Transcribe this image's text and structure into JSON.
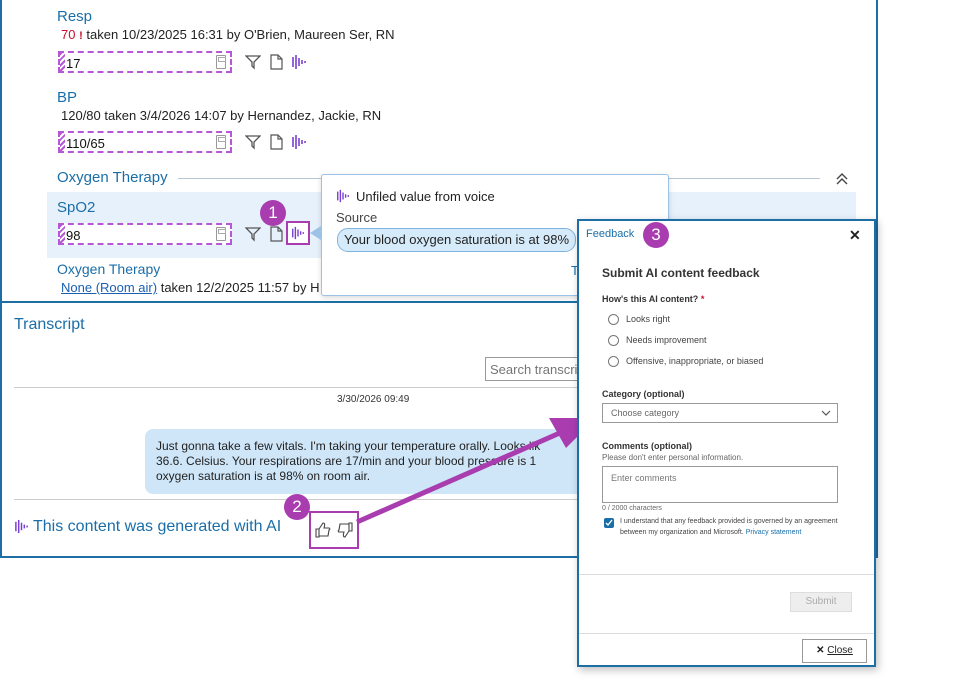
{
  "vitals": {
    "resp": {
      "label": "Resp",
      "prev_value": "70",
      "warn_icon": "!",
      "taken": "taken 10/23/2025 16:31 by O'Brien, Maureen Ser, RN",
      "input_value": "17"
    },
    "bp": {
      "label": "BP",
      "prev_value": "120/80",
      "taken": "taken 3/4/2026 14:07 by Hernandez, Jackie, RN",
      "input_value": "110/65"
    },
    "oxygen_section": {
      "title": "Oxygen Therapy"
    },
    "spo2": {
      "label": "SpO2",
      "input_value": "98"
    },
    "oxygen_row": {
      "label": "Oxygen Therapy",
      "prev_value": "None (Room air)",
      "taken": "taken 12/2/2025 11:57 by H"
    }
  },
  "popup": {
    "title": "Unfiled value from voice",
    "source_label": "Source",
    "source_text": "Your blood oxygen saturation is at 98%",
    "truncated_link": "T"
  },
  "transcript": {
    "title": "Transcript",
    "search_placeholder": "Search transcri",
    "timestamp": "3/30/2026 09:49",
    "bubble_line1": "Just gonna take a few vitals. I'm taking your temperature orally. Looks lik",
    "bubble_line2": "36.6. Celsius. Your respirations are 17/min and your blood pressure is 1",
    "bubble_line3": "oxygen saturation is at 98% on room air.",
    "ai_notice": "This content was generated with AI"
  },
  "callouts": {
    "one": "1",
    "two": "2",
    "three": "3"
  },
  "feedback": {
    "header_link": "Feedback",
    "title": "Submit AI content feedback",
    "question": "How's this AI content?",
    "required_mark": "*",
    "options": [
      "Looks right",
      "Needs improvement",
      "Offensive, inappropriate, or biased"
    ],
    "category_label": "Category (optional)",
    "category_placeholder": "Choose category",
    "comments_label": "Comments (optional)",
    "comments_hint": "Please don't enter personal information.",
    "comments_placeholder": "Enter comments",
    "char_count": "0 / 2000 characters",
    "consent_line1": "I understand that any feedback provided is governed by an agreement",
    "consent_line2": "between my organization and Microsoft.",
    "privacy_link": "Privacy statement",
    "submit": "Submit",
    "close": "Close",
    "close_x": "✕",
    "checkbox_checked": true
  },
  "colors": {
    "accent": "#1a6ea8",
    "annotation": "#a93db0",
    "dashed": "#b657d6",
    "warn": "#c8102e",
    "bubble": "#cfe6f8"
  },
  "icons": [
    "calculator-icon",
    "filter-icon",
    "document-icon",
    "voice-wave-icon",
    "chevron-up-icon",
    "close-icon",
    "thumbs-up-icon",
    "thumbs-down-icon",
    "dropdown-chevron-icon",
    "checkbox-icon"
  ]
}
